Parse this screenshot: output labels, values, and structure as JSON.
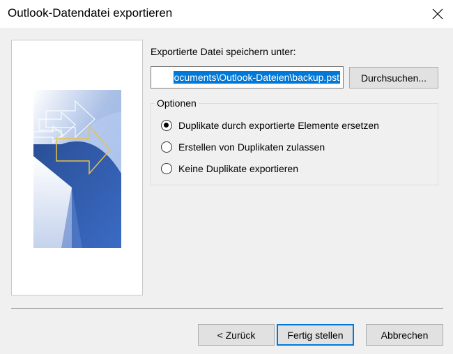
{
  "window": {
    "title": "Outlook-Datendatei exportieren",
    "close_icon": "close-icon"
  },
  "save_section": {
    "label": "Exportierte Datei speichern unter:",
    "path_value": "ocuments\\Outlook-Dateien\\backup.pst",
    "browse_label": "Durchsuchen..."
  },
  "options": {
    "legend": "Optionen",
    "items": [
      {
        "label": "Duplikate durch exportierte Elemente ersetzen",
        "checked": true
      },
      {
        "label": "Erstellen von Duplikaten zulassen",
        "checked": false
      },
      {
        "label": "Keine Duplikate exportieren",
        "checked": false
      }
    ]
  },
  "footer": {
    "back_label": "< Zurück",
    "finish_label": "Fertig stellen",
    "cancel_label": "Abbrechen"
  },
  "colors": {
    "selection": "#0078d7",
    "wizard_blue": "#2f56a0",
    "arrow_gold": "#e8c24a"
  }
}
